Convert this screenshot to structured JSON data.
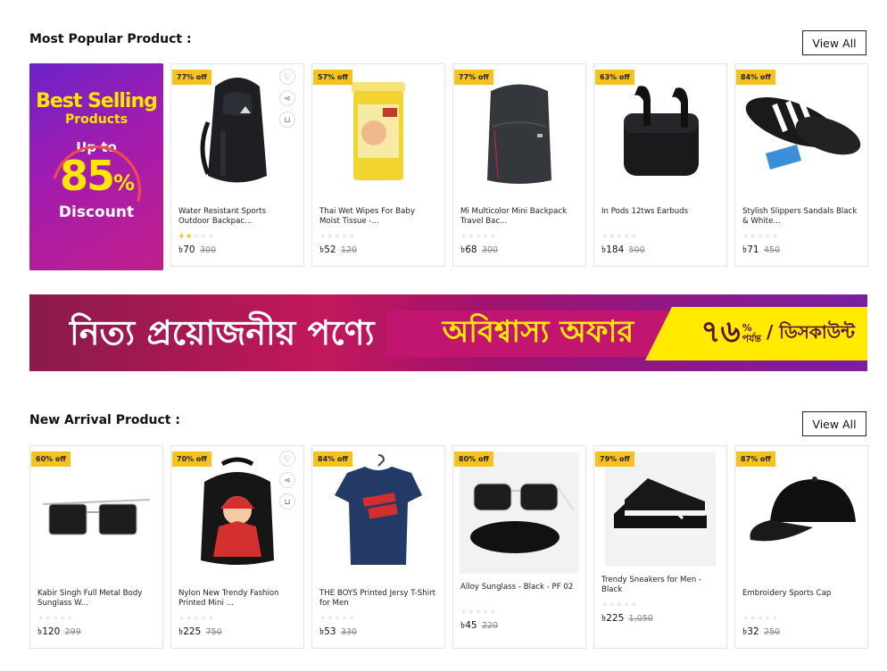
{
  "popular": {
    "title": "Most Popular Product :",
    "view_all": "View All",
    "promo": {
      "line1": "Best Selling",
      "line2": "Products",
      "line3": "Up to",
      "percent": "85",
      "percent_sign": "%",
      "line4": "Discount"
    },
    "products": [
      {
        "badge": "77% off",
        "name": "Water Resistant Sports Outdoor Backpac...",
        "rating": 2,
        "price": "৳70",
        "old_price": "300",
        "image": "backpack-black"
      },
      {
        "badge": "57% off",
        "name": "Thai Wet Wipes For Baby Moist Tissue -...",
        "rating": 0,
        "price": "৳52",
        "old_price": "120",
        "image": "wet-wipes"
      },
      {
        "badge": "77% off",
        "name": "Mi Multicolor Mini Backpack Travel Bac...",
        "rating": 0,
        "price": "৳68",
        "old_price": "300",
        "image": "backpack-grey"
      },
      {
        "badge": "63% off",
        "name": "In Pods 12tws Earbuds",
        "rating": 0,
        "price": "৳184",
        "old_price": "500",
        "image": "earbuds"
      },
      {
        "badge": "84% off",
        "name": "Stylish Slippers Sandals Black & White...",
        "rating": 0,
        "price": "৳71",
        "old_price": "450",
        "image": "slippers"
      }
    ]
  },
  "banner": {
    "left_text": "নিত্য প্রয়োজনীয় পণ্যে",
    "mid_text": "অবিশ্বাস্য অফার",
    "number": "৭৬",
    "percent_sign": "%",
    "suffix": "পর্যন্ত",
    "discount": "/ ডিসকাউন্ট"
  },
  "arrival": {
    "title": "New Arrival Product :",
    "view_all": "View All",
    "products": [
      {
        "badge": "60% off",
        "name": "Kabir Singh Full Metal Body Sunglass W...",
        "rating": 0,
        "price": "৳120",
        "old_price": "299",
        "image": "sunglass-square"
      },
      {
        "badge": "70% off",
        "name": "Nylon New Trendy Fashion Printed Mini ...",
        "rating": 0,
        "price": "৳225",
        "old_price": "750",
        "image": "mini-backpack-girl"
      },
      {
        "badge": "84% off",
        "name": "THE BOYS Printed Jersy T-Shirt for Men",
        "rating": 0,
        "price": "৳53",
        "old_price": "330",
        "image": "tshirt-boys"
      },
      {
        "badge": "80% off",
        "name": "Alloy Sunglass - Black - PF 02",
        "rating": 0,
        "price": "৳45",
        "old_price": "220",
        "image": "sunglass-case"
      },
      {
        "badge": "79% off",
        "name": "Trendy Sneakers for Men - Black",
        "rating": 0,
        "price": "৳225",
        "old_price": "1,050",
        "image": "sneakers"
      },
      {
        "badge": "87% off",
        "name": "Embroidery Sports Cap",
        "rating": 0,
        "price": "৳32",
        "old_price": "250",
        "image": "cap"
      }
    ]
  },
  "colors": {
    "badge": "#f7c21b",
    "star_on": "#f2b705",
    "star_off": "#e6e6e6"
  }
}
